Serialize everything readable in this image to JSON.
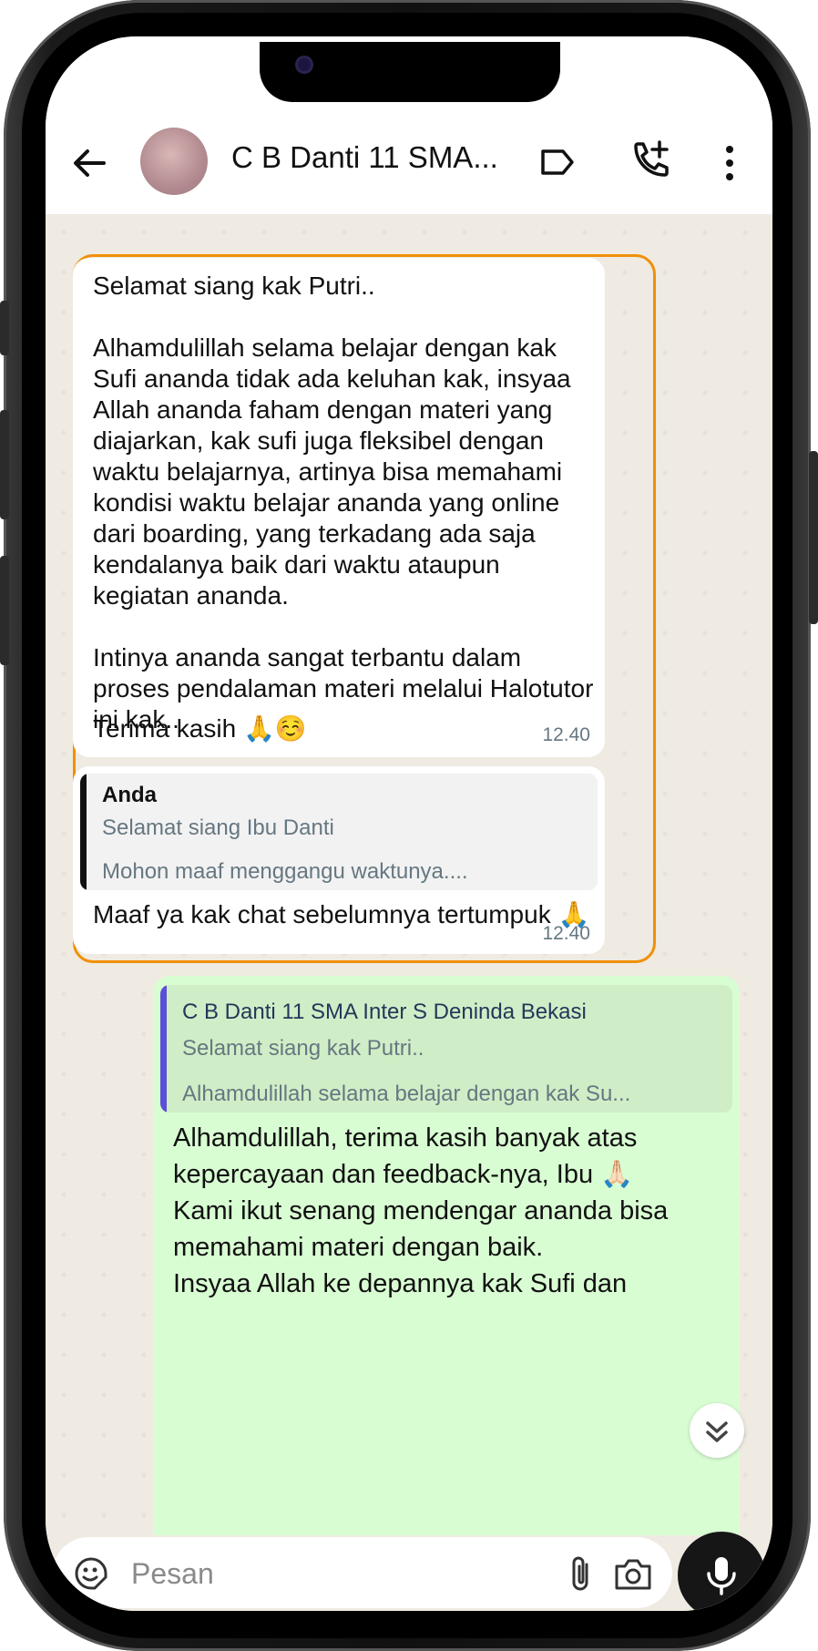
{
  "header": {
    "title": "C B Danti 11 SMA...",
    "back_icon": "arrow-left-icon",
    "label_icon": "label-tag-icon",
    "call_icon": "add-call-icon",
    "menu_icon": "more-vert-icon"
  },
  "messages": [
    {
      "type": "incoming",
      "text": "Selamat siang kak Putri..\n\nAlhamdulillah selama belajar dengan kak Sufi ananda tidak ada keluhan kak, insyaa Allah ananda faham dengan materi yang diajarkan, kak sufi juga fleksibel dengan waktu belajarnya, artinya bisa memahami kondisi waktu belajar ananda yang online dari boarding, yang terkadang ada saja kendalanya baik dari waktu ataupun kegiatan ananda.\n\nIntinya ananda sangat terbantu dalam proses pendalaman materi melalui Halotutor ini kak..",
      "closing": "Terima kasih 🙏☺️",
      "time": "12.40"
    },
    {
      "type": "incoming",
      "quote": {
        "name": "Anda",
        "line1": "Selamat siang Ibu Danti",
        "line2": "Mohon maaf menggangu waktunya...."
      },
      "text": "Maaf ya kak chat sebelumnya tertumpuk 🙏",
      "time": "12.40"
    },
    {
      "type": "outgoing",
      "quote": {
        "name": "C B Danti 11 SMA Inter S Deninda Bekasi",
        "line1": "Selamat siang kak Putri..",
        "line2": "Alhamdulillah selama belajar dengan kak Su..."
      },
      "text": "Alhamdulillah, terima kasih banyak atas kepercayaan dan feedback-nya, Ibu 🙏🏻\nKami ikut senang mendengar ananda bisa memahami materi dengan baik.\nInsyaa Allah ke depannya kak Sufi dan"
    }
  ],
  "input": {
    "placeholder": "Pesan",
    "emoji_icon": "sticker-icon",
    "attach_icon": "paperclip-icon",
    "camera_icon": "camera-icon",
    "mic_icon": "microphone-icon"
  },
  "colors": {
    "highlight_border": "#f0900a",
    "outgoing_bubble": "#d9fdd3",
    "quote_bar_own": "#111111",
    "quote_bar_other": "#5b4fd6",
    "chat_bg": "#efeae2"
  }
}
